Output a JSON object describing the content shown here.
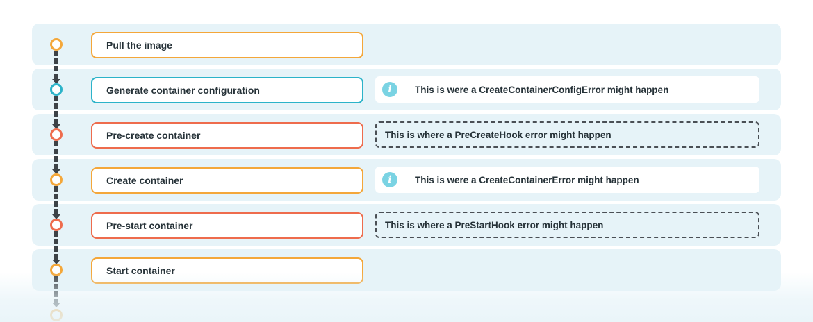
{
  "steps": [
    {
      "label": "Pull the image",
      "color": "#f4a73a"
    },
    {
      "label": "Generate container configuration",
      "color": "#2cb3c9"
    },
    {
      "label": "Pre-create container",
      "color": "#ee6c4d"
    },
    {
      "label": "Create container",
      "color": "#f4a73a"
    },
    {
      "label": "Pre-start container",
      "color": "#ee6c4d"
    },
    {
      "label": "Start container",
      "color": "#f4a73a"
    }
  ],
  "notes": {
    "config_error": {
      "icon": "info-icon",
      "text": "This is were a CreateContainerConfigError might happen"
    },
    "precreate_hook": {
      "text": "This is where a PreCreateHook error might happen"
    },
    "create_error": {
      "icon": "info-icon",
      "text": "This is were a CreateContainerError might happen"
    },
    "prestart_hook": {
      "text": "This is where a PreStartHook error might happen"
    }
  },
  "colors": {
    "row_background": "#e6f3f8",
    "orange": "#f4a73a",
    "teal": "#2cb3c9",
    "red": "#ee6c4d",
    "connector": "#3d4247",
    "info_icon": "#7ad3e3"
  }
}
